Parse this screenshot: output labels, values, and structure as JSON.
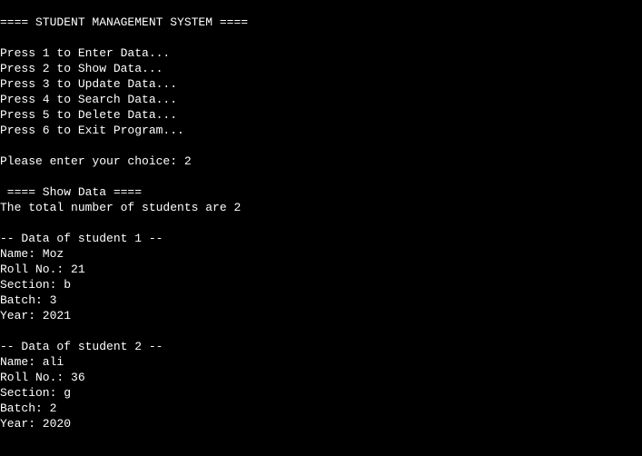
{
  "console": {
    "header": "==== STUDENT MANAGEMENT SYSTEM ====",
    "menu": [
      "Press 1 to Enter Data...",
      "Press 2 to Show Data...",
      "Press 3 to Update Data...",
      "Press 4 to Search Data...",
      "Press 5 to Delete Data...",
      "Press 6 to Exit Program..."
    ],
    "prompt": "Please enter your choice: 2",
    "section_title": " ==== Show Data ====",
    "total_line": "The total number of students are 2",
    "students": [
      {
        "heading": "-- Data of student 1 --",
        "name": "Name: Moz",
        "roll": "Roll No.: 21",
        "section": "Section: b",
        "batch": "Batch: 3",
        "year": "Year: 2021"
      },
      {
        "heading": "-- Data of student 2 --",
        "name": "Name: ali",
        "roll": "Roll No.: 36",
        "section": "Section: g",
        "batch": "Batch: 2",
        "year": "Year: 2020"
      }
    ]
  },
  "colors": {
    "background": "#000000",
    "text": "#ffffff"
  }
}
